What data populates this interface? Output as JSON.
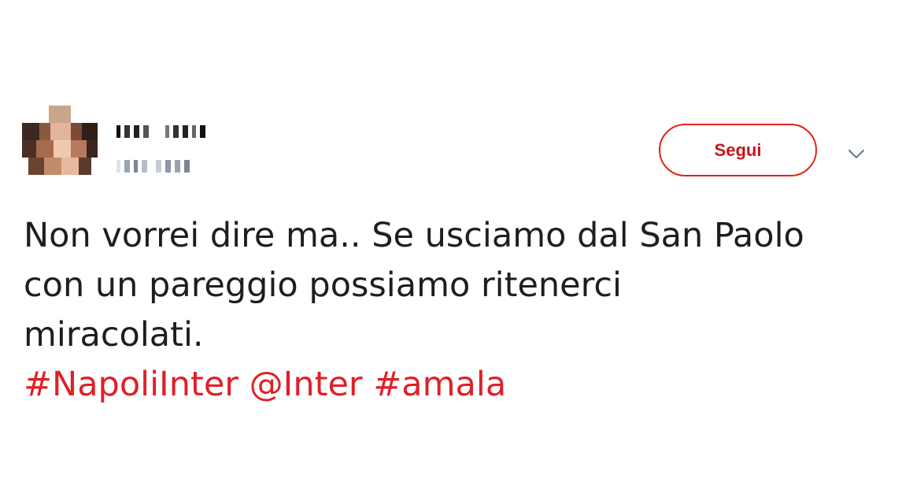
{
  "tweet": {
    "follow_label": "Segui",
    "text_lines": [
      "Non vorrei dire ma.. Se usciamo dal San Paolo",
      "con un pareggio possiamo ritenerci",
      "miracolati."
    ],
    "hashtag_1": "#NapoliInter",
    "mention": "@Inter",
    "hashtag_2": "#amala"
  },
  "colors": {
    "accent": "#e2231a",
    "link": "#e01f26",
    "text": "#1e1e1e"
  },
  "icons": {
    "menu": "chevron-down-icon"
  }
}
